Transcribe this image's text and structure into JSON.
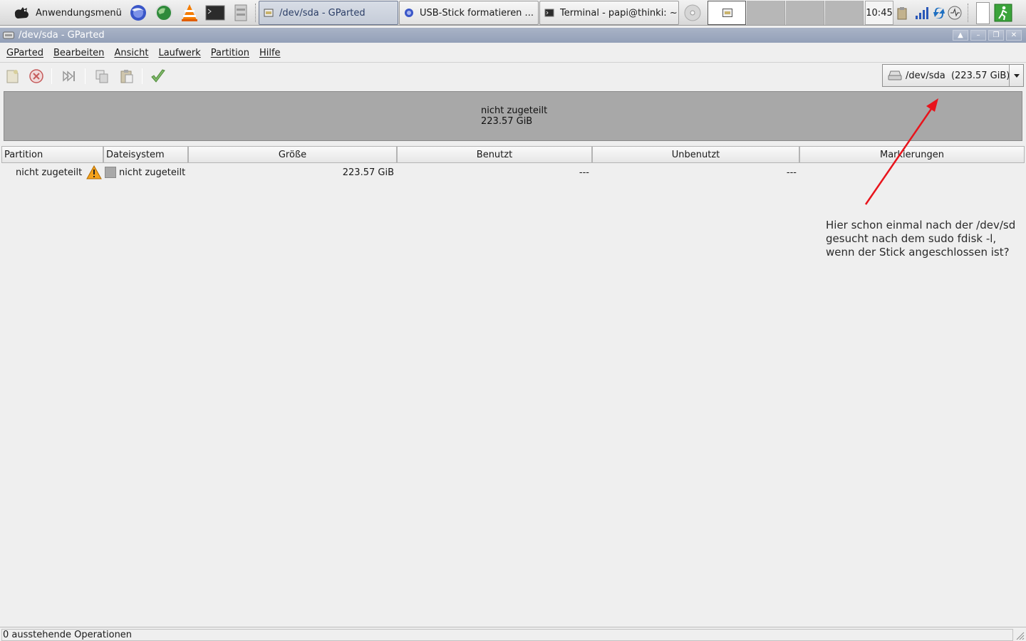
{
  "panel": {
    "app_menu_label": "Anwendungsmenü",
    "launchers": [
      "browser-icon",
      "web-globe-icon",
      "vlc-icon",
      "terminal-icon",
      "file-manager-icon"
    ],
    "tasks": [
      {
        "label": "/dev/sda - GParted",
        "icon": "gparted-icon",
        "active": true
      },
      {
        "label": "USB-Stick formatieren ...",
        "icon": "browser-icon",
        "active": false
      },
      {
        "label": "Terminal - papi@thinki: ~",
        "icon": "terminal-icon",
        "active": false
      }
    ],
    "workspaces": 4,
    "current_workspace": 1,
    "clock": "10:45",
    "tray_icons": [
      "clipboard-icon",
      "network-signal-icon",
      "update-icon",
      "system-monitor-icon",
      "logout-icon"
    ]
  },
  "window": {
    "title": "/dev/sda - GParted",
    "controls": [
      "shade-up-button",
      "minimize-button",
      "maximize-button",
      "close-button"
    ]
  },
  "menubar": {
    "items": [
      "GParted",
      "Bearbeiten",
      "Ansicht",
      "Laufwerk",
      "Partition",
      "Hilfe"
    ]
  },
  "toolbar": {
    "device_label": "/dev/sda  (223.57 GiB)",
    "buttons": [
      "new-partition-icon",
      "delete-icon",
      "resize-move-icon",
      "copy-icon",
      "paste-icon",
      "apply-icon"
    ]
  },
  "diskmap": {
    "label_line1": "nicht zugeteilt",
    "label_line2": "223.57 GiB",
    "fill_color": "#a8a8a8"
  },
  "table": {
    "columns": [
      "Partition",
      "Dateisystem",
      "Größe",
      "Benutzt",
      "Unbenutzt",
      "Markierungen"
    ],
    "rows": [
      {
        "partition": "nicht zugeteilt",
        "filesystem": "nicht zugeteilt",
        "size": "223.57 GiB",
        "used": "---",
        "unused": "---",
        "flags": ""
      }
    ]
  },
  "annotation": {
    "lines": [
      "Hier schon einmal nach der /dev/sd",
      "gesucht nach dem sudo fdisk -l,",
      "wenn der Stick angeschlossen ist?"
    ],
    "arrow_color": "#e8141c"
  },
  "statusbar": {
    "text": "0 ausstehende Operationen"
  }
}
